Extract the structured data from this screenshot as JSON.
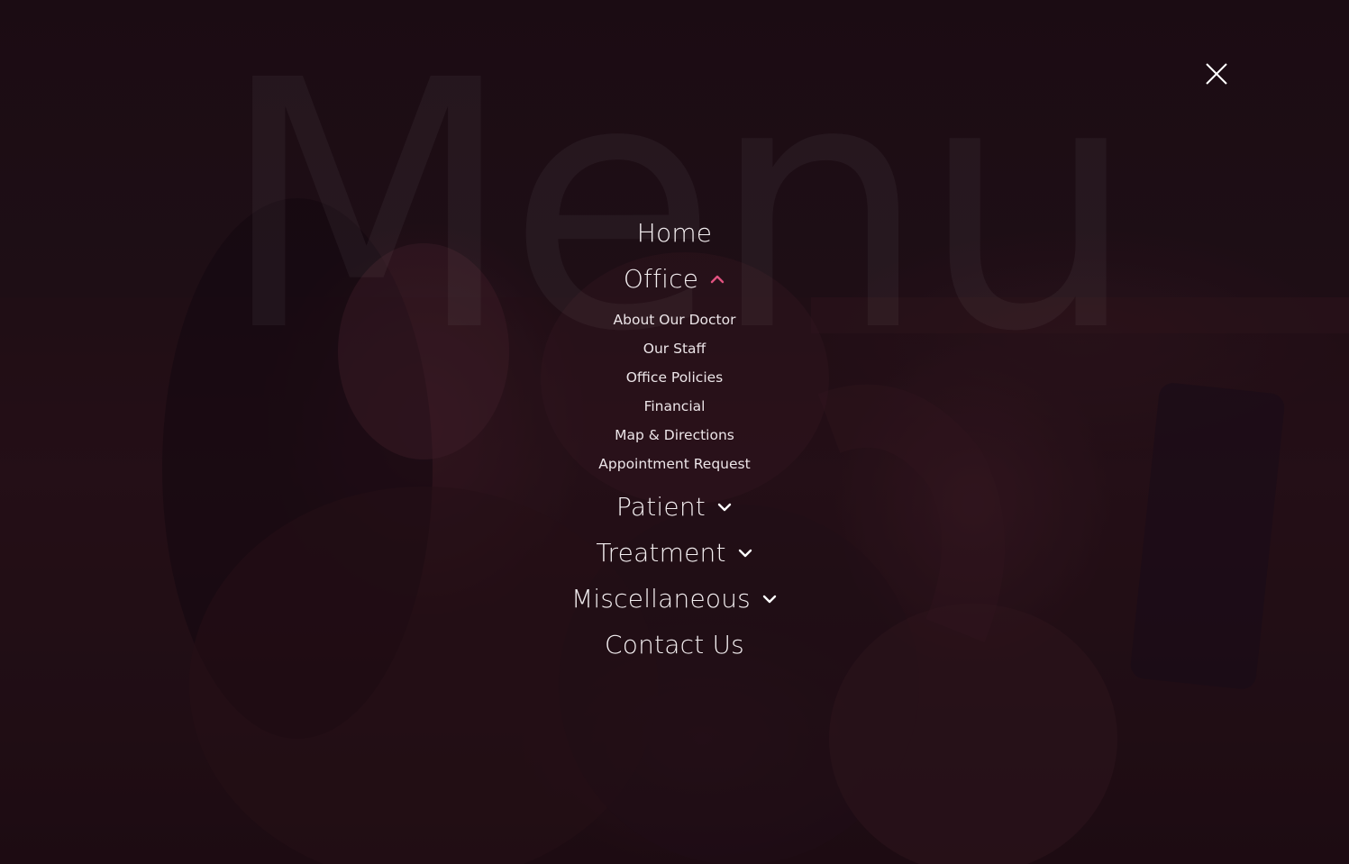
{
  "overlay": {
    "watermark_text": "Menu",
    "close_icon": "close-icon",
    "accent_color": "#e0527f"
  },
  "menu": {
    "home": {
      "label": "Home"
    },
    "office": {
      "label": "Office",
      "expanded": true,
      "icon": "chevron-up-icon",
      "children": [
        {
          "label": "About Our Doctor"
        },
        {
          "label": "Our Staff"
        },
        {
          "label": "Office Policies"
        },
        {
          "label": "Financial"
        },
        {
          "label": "Map & Directions"
        },
        {
          "label": "Appointment Request"
        }
      ]
    },
    "patient": {
      "label": "Patient",
      "icon": "chevron-down-icon"
    },
    "treatment": {
      "label": "Treatment",
      "icon": "chevron-down-icon"
    },
    "miscellaneous": {
      "label": "Miscellaneous",
      "icon": "chevron-down-icon"
    },
    "contact": {
      "label": "Contact Us"
    }
  }
}
